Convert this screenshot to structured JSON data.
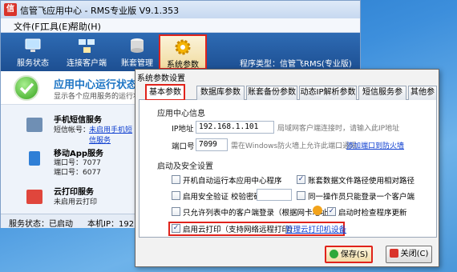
{
  "main_window": {
    "title": "信管飞应用中心 - RMS专业版 V9.1.353",
    "app_icon_text": "信",
    "menu": [
      "文件(F)",
      "工具(E)",
      "帮助(H)"
    ],
    "toolbar": {
      "buttons": [
        "服务状态",
        "连接客户端",
        "账套管理",
        "系统参数"
      ],
      "brand": "程序类型：信管飞RMS(专业版)"
    },
    "status_header": {
      "title": "应用中心运行状态",
      "subtitle": "显示各个应用服务的运行状态"
    },
    "services": {
      "sms": {
        "title": "手机短信服务",
        "line1_prefix": "短信帐号：",
        "line1_link": "未启用手机短信服务"
      },
      "mobile": {
        "title": "移动App服务",
        "line1": "端口号：7077",
        "line2": "端口号：6077"
      },
      "cloud": {
        "title": "云打印服务",
        "line1": "未启用云打印"
      }
    },
    "statusbar": {
      "state": "服务状态：已启动",
      "local_ip": "本机IP：192.16"
    }
  },
  "dialog": {
    "title": "系统参数设置",
    "tabs": [
      "基本参数",
      "数据库参数",
      "账套备份参数",
      "动态IP解析参数",
      "短信服务参数",
      "其他参"
    ],
    "app_center_section": "应用中心信息",
    "ip_label": "IP地址",
    "ip_value": "192.168.1.101",
    "ip_hint": "局域网客户端连接时，请输入此IP地址",
    "port_label": "端口号",
    "port_value": "7099",
    "port_hint": "需在Windows防火墙上允许此端口通讯",
    "port_link": "添加端口到防火墙",
    "startup_section": "启动及安全设置",
    "checks": {
      "autorun": {
        "label": "开机自动运行本应用中心程序",
        "checked": false
      },
      "relative_path": {
        "label": "账套数据文件路径使用相对路径",
        "checked": true
      },
      "security": {
        "label": "启用安全验证  校验密码：",
        "checked": false
      },
      "single_login": {
        "label": "同一操作员只能登录一个客户端",
        "checked": false
      },
      "whitelist": {
        "label": "只允许列表中的客户端登录（根据网卡地址）",
        "checked": false
      },
      "auto_update": {
        "label": "启动时检查程序更新",
        "checked": true
      },
      "cloud_print": {
        "label": "启用云打印（支持网络远程打印）",
        "checked": true
      }
    },
    "cloud_manage_link": "管理云打印机设备",
    "save_label": "保存(S)",
    "close_label": "关闭(C)"
  }
}
